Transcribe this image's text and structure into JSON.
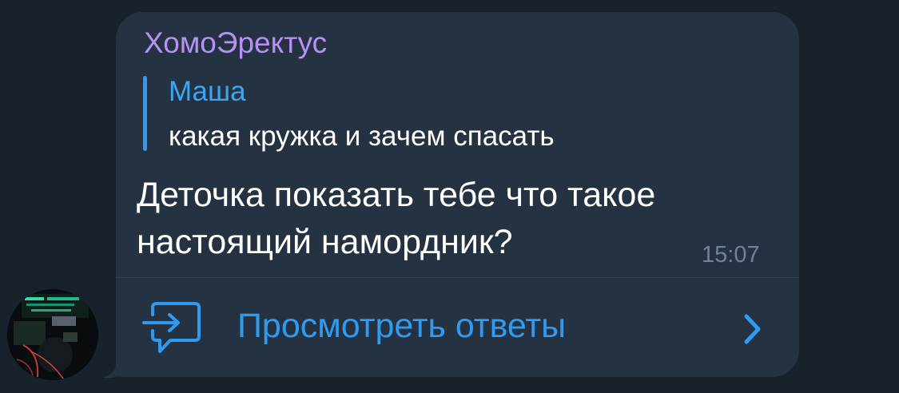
{
  "message": {
    "sender": "ХомоЭректус",
    "reply": {
      "author": "Маша",
      "text": "какая кружка и зачем спасать"
    },
    "text_lines": [
      "Деточка показать тебе что такое",
      "настоящий намордник?"
    ],
    "time": "15:07",
    "view_replies_label": "Просмотреть ответы"
  },
  "colors": {
    "background": "#18222d",
    "bubble": "#243242",
    "sender_name": "#b791f2",
    "accent": "#2f9bf0",
    "time": "#6f8396"
  },
  "icons": {
    "replies": "reply-arrow-speech-bubble-icon",
    "chevron": "chevron-right-icon",
    "avatar": "user-avatar-photo"
  }
}
